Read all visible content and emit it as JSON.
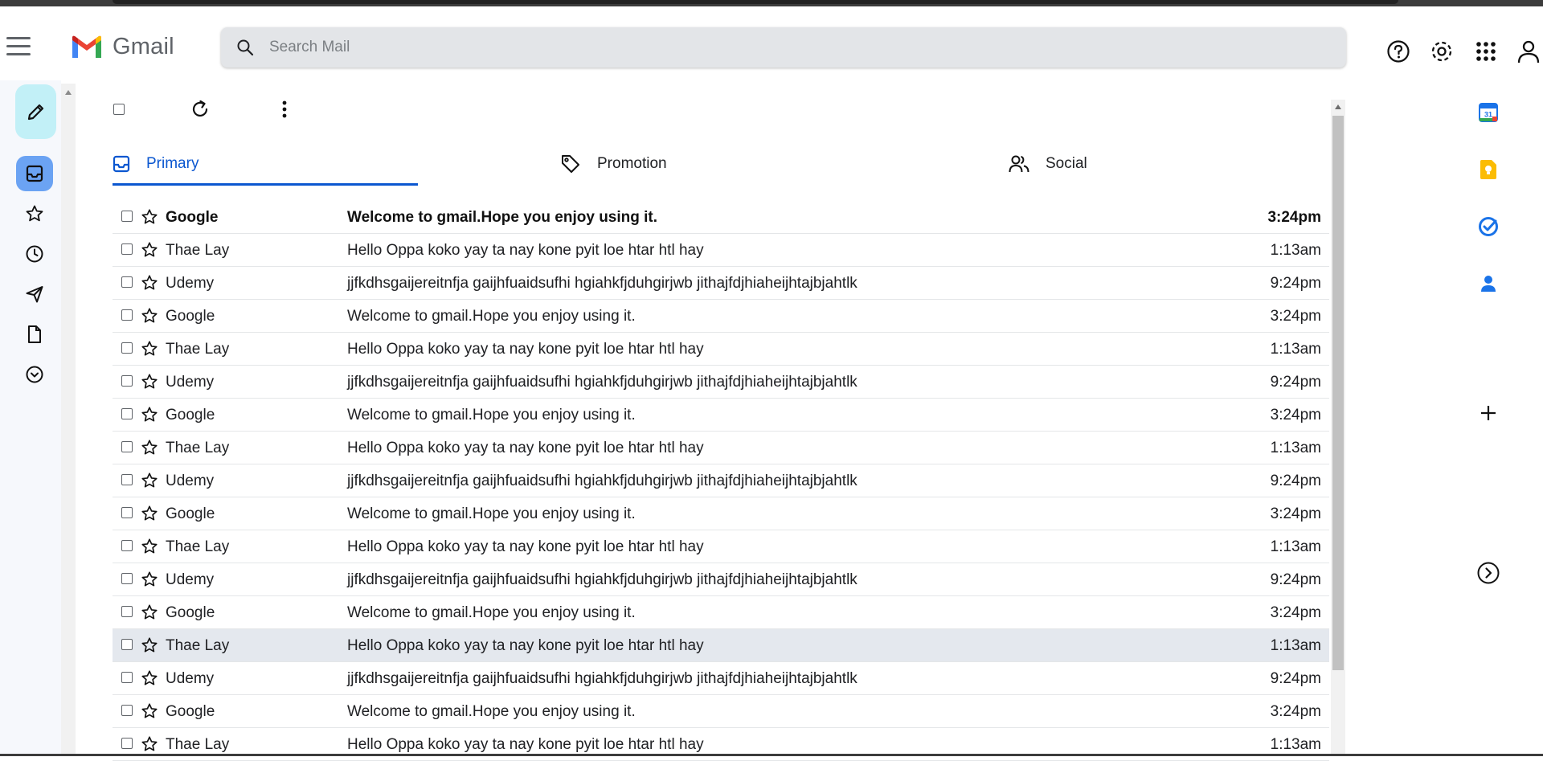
{
  "app": {
    "name": "Gmail"
  },
  "search": {
    "placeholder": "Search Mail",
    "value": ""
  },
  "tabs": [
    {
      "label": "Primary",
      "active": true,
      "icon": "inbox-icon"
    },
    {
      "label": "Promotion",
      "active": false,
      "icon": "tag-icon"
    },
    {
      "label": "Social",
      "active": false,
      "icon": "people-icon"
    }
  ],
  "emails": [
    {
      "sender": "Google",
      "subject": "Welcome to gmail.Hope you enjoy using it.",
      "time": "3:24pm",
      "unread": true
    },
    {
      "sender": "Thae Lay",
      "subject": "Hello Oppa koko yay ta nay kone pyit loe htar htl hay",
      "time": "1:13am"
    },
    {
      "sender": "Udemy",
      "subject": "jjfkdhsgaijereitnfja gaijhfuaidsufhi hgiahkfjduhgirjwb jithajfdjhiaheijhtajbjahtlk",
      "time": "9:24pm"
    },
    {
      "sender": "Google",
      "subject": "Welcome to gmail.Hope you enjoy using it.",
      "time": "3:24pm"
    },
    {
      "sender": "Thae Lay",
      "subject": "Hello Oppa koko yay ta nay kone pyit loe htar htl hay",
      "time": "1:13am"
    },
    {
      "sender": "Udemy",
      "subject": "jjfkdhsgaijereitnfja gaijhfuaidsufhi hgiahkfjduhgirjwb jithajfdjhiaheijhtajbjahtlk",
      "time": "9:24pm"
    },
    {
      "sender": "Google",
      "subject": "Welcome to gmail.Hope you enjoy using it.",
      "time": "3:24pm"
    },
    {
      "sender": "Thae Lay",
      "subject": "Hello Oppa koko yay ta nay kone pyit loe htar htl hay",
      "time": "1:13am"
    },
    {
      "sender": "Udemy",
      "subject": "jjfkdhsgaijereitnfja gaijhfuaidsufhi hgiahkfjduhgirjwb jithajfdjhiaheijhtajbjahtlk",
      "time": "9:24pm"
    },
    {
      "sender": "Google",
      "subject": "Welcome to gmail.Hope you enjoy using it.",
      "time": "3:24pm"
    },
    {
      "sender": "Thae Lay",
      "subject": "Hello Oppa koko yay ta nay kone pyit loe htar htl hay",
      "time": "1:13am"
    },
    {
      "sender": "Udemy",
      "subject": "jjfkdhsgaijereitnfja gaijhfuaidsufhi hgiahkfjduhgirjwb jithajfdjhiaheijhtajbjahtlk",
      "time": "9:24pm"
    },
    {
      "sender": "Google",
      "subject": "Welcome to gmail.Hope you enjoy using it.",
      "time": "3:24pm"
    },
    {
      "sender": "Thae Lay",
      "subject": "Hello Oppa koko yay ta nay kone pyit loe htar htl hay",
      "time": "1:13am",
      "highlighted": true
    },
    {
      "sender": "Udemy",
      "subject": "jjfkdhsgaijereitnfja gaijhfuaidsufhi hgiahkfjduhgirjwb jithajfdjhiaheijhtajbjahtlk",
      "time": "9:24pm"
    },
    {
      "sender": "Google",
      "subject": "Welcome to gmail.Hope you enjoy using it.",
      "time": "3:24pm"
    },
    {
      "sender": "Thae Lay",
      "subject": "Hello Oppa koko yay ta nay kone pyit loe htar htl hay",
      "time": "1:13am"
    }
  ],
  "side_apps": {
    "calendar_day": "31"
  },
  "colors": {
    "accent": "#0b57d0",
    "compose_bg": "#c2f0f7",
    "inbox_active_bg": "#6ba3f3",
    "search_bg": "#e3e5e8",
    "row_highlight": "#e4e8ee",
    "keep_yellow": "#fbbc04",
    "tasks_blue": "#1a73e8"
  }
}
